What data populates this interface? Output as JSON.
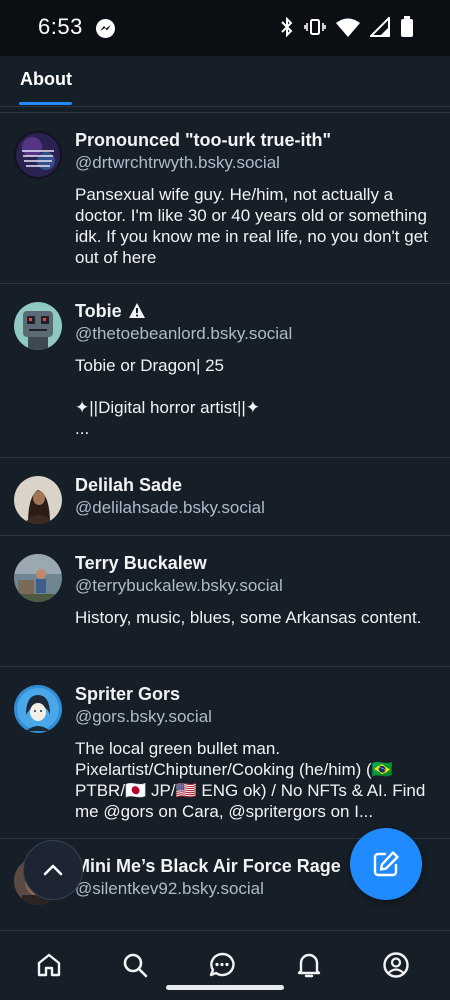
{
  "status_bar": {
    "time": "6:53"
  },
  "tabs": [
    {
      "label": "About",
      "active": true
    }
  ],
  "accent_color": "#208bfe",
  "profiles": [
    {
      "name": "Pronounced \"too-urk true-ith\"",
      "handle": "@drtwrchtrwyth.bsky.social",
      "bio": "Pansexual wife guy. He/him, not actually a doctor. I'm like 30 or 40 years old or something idk. If you know me in real life, no you don't get out of here"
    },
    {
      "name": "Tobie",
      "handle": "@thetoebeanlord.bsky.social",
      "bio": "Tobie or Dragon| 25\n\n✦||Digital horror artist||✦\n..."
    },
    {
      "name": "Delilah Sade",
      "handle": "@delilahsade.bsky.social",
      "bio": ""
    },
    {
      "name": "Terry Buckalew",
      "handle": "@terrybuckalew.bsky.social",
      "bio": "History, music, blues, some Arkansas content."
    },
    {
      "name": "Spriter Gors",
      "handle": "@gors.bsky.social",
      "bio": "The local green bullet man. Pixelartist/Chiptuner/Cooking (he/him) (🇧🇷 PTBR/🇯🇵 JP/🇺🇸 ENG ok) / No NFTs & AI. Find me @gors on Cara, @spritergors on I..."
    },
    {
      "name": "Mini Me’s Black Air Force Rage",
      "handle": "@silentkev92.bsky.social",
      "bio": ""
    }
  ],
  "bottom_nav": [
    "home-icon",
    "search-icon",
    "chat-icon",
    "bell-icon",
    "profile-icon"
  ]
}
